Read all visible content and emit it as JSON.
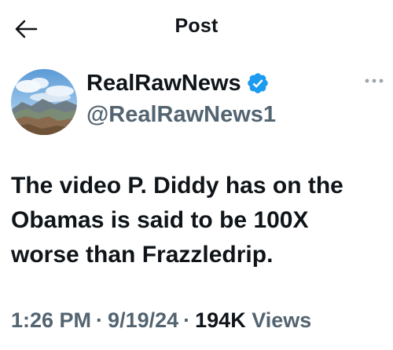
{
  "header": {
    "title": "Post",
    "back_icon": "arrow-left-icon"
  },
  "post": {
    "author": {
      "display_name": "RealRawNews",
      "handle": "@RealRawNews1",
      "verified": true,
      "verified_color": "#1d9bf0",
      "avatar_description": "mountain landscape"
    },
    "more_icon": "more-horizontal-icon",
    "text": "The video P. Diddy has on the\nObamas is said to be 100X\nworse than Frazzledrip.",
    "time": "1:26 PM",
    "date": "9/19/24",
    "views_count": "194K",
    "views_label": "Views",
    "separator": "·"
  },
  "colors": {
    "text": "#0f1419",
    "secondary": "#536471",
    "accent": "#1d9bf0"
  }
}
